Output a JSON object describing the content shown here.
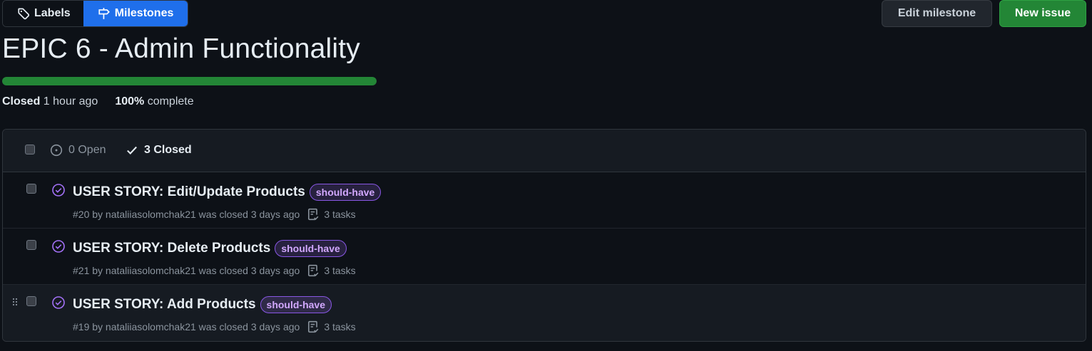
{
  "nav": {
    "labels": "Labels",
    "milestones": "Milestones"
  },
  "actions": {
    "edit": "Edit milestone",
    "new": "New issue"
  },
  "milestone": {
    "title": "EPIC 6 - Admin Functionality",
    "progress_fraction": 1.0,
    "closed_label": "Closed",
    "closed_time": "1 hour ago",
    "percent": "100%",
    "complete_label": "complete"
  },
  "issues_header": {
    "open": "0 Open",
    "closed": "3 Closed"
  },
  "issues": [
    {
      "title": "USER STORY: Edit/Update Products",
      "label": "should-have",
      "meta": "#20 by nataliiasolomchak21 was closed 3 days ago",
      "tasks": "3 tasks"
    },
    {
      "title": "USER STORY: Delete Products",
      "label": "should-have",
      "meta": "#21 by nataliiasolomchak21 was closed 3 days ago",
      "tasks": "3 tasks"
    },
    {
      "title": "USER STORY: Add Products",
      "label": "should-have",
      "meta": "#19 by nataliiasolomchak21 was closed 3 days ago",
      "tasks": "3 tasks"
    }
  ],
  "colors": {
    "accent": "#1f6feb",
    "success": "#238636",
    "closed_icon": "#a371f7",
    "label": "#d2a8ff"
  },
  "icons": {
    "labels": "tag-icon",
    "milestones": "milestone-icon",
    "open": "issue-open-icon",
    "closed": "check-icon",
    "issue_closed": "issue-closed-icon",
    "tasks": "tasklist-icon",
    "drag": "grabber-icon"
  }
}
